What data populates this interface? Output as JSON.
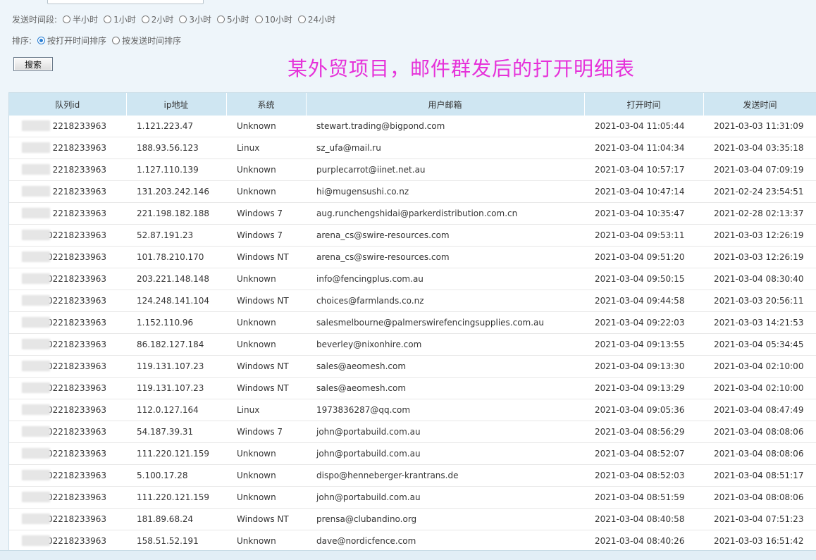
{
  "filters": {
    "send_period_label": "发送时间段:",
    "send_period_options": [
      "半小时",
      "1小时",
      "2小时",
      "3小时",
      "5小时",
      "10小时",
      "24小时"
    ],
    "sort_label": "排序:",
    "sort_options": [
      "按打开时间排序",
      "按发送时间排序"
    ],
    "sort_selected": 0,
    "search_button": "搜索"
  },
  "overlay_caption": "某外贸项目，邮件群发后的打开明细表",
  "table": {
    "columns": [
      "队列id",
      "ip地址",
      "系统",
      "用户邮箱",
      "打开时间",
      "发送时间"
    ],
    "rows": [
      [
        "2218233963",
        "1.121.223.47",
        "Unknown",
        "stewart.trading@bigpond.com",
        "2021-03-04 11:05:44",
        "2021-03-03 11:31:09"
      ],
      [
        "2218233963",
        "188.93.56.123",
        "Linux",
        "sz_ufa@mail.ru",
        "2021-03-04 11:04:34",
        "2021-03-04 03:35:18"
      ],
      [
        "2218233963",
        "1.127.110.139",
        "Unknown",
        "purplecarrot@iinet.net.au",
        "2021-03-04 10:57:17",
        "2021-03-04 07:09:19"
      ],
      [
        "2218233963",
        "131.203.242.146",
        "Unknown",
        "hi@mugensushi.co.nz",
        "2021-03-04 10:47:14",
        "2021-02-24 23:54:51"
      ],
      [
        "2218233963",
        "221.198.182.188",
        "Windows 7",
        "aug.runchengshidai@parkerdistribution.com.cn",
        "2021-03-04 10:35:47",
        "2021-02-28 02:13:37"
      ],
      [
        "02218233963",
        "52.87.191.23",
        "Windows 7",
        "arena_cs@swire-resources.com",
        "2021-03-04 09:53:11",
        "2021-03-03 12:26:19"
      ],
      [
        "02218233963",
        "101.78.210.170",
        "Windows NT",
        "arena_cs@swire-resources.com",
        "2021-03-04 09:51:20",
        "2021-03-03 12:26:19"
      ],
      [
        "102218233963",
        "203.221.148.148",
        "Unknown",
        "info@fencingplus.com.au",
        "2021-03-04 09:50:15",
        "2021-03-04 08:30:40"
      ],
      [
        "102218233963",
        "124.248.141.104",
        "Windows NT",
        "choices@farmlands.co.nz",
        "2021-03-04 09:44:58",
        "2021-03-03 20:56:11"
      ],
      [
        "102218233963",
        "1.152.110.96",
        "Unknown",
        "salesmelbourne@palmerswirefencingsupplies.com.au",
        "2021-03-04 09:22:03",
        "2021-03-03 14:21:53"
      ],
      [
        "102218233963",
        "86.182.127.184",
        "Unknown",
        "beverley@nixonhire.com",
        "2021-03-04 09:13:55",
        "2021-03-04 05:34:45"
      ],
      [
        "102218233963",
        "119.131.107.23",
        "Windows NT",
        "sales@aeomesh.com",
        "2021-03-04 09:13:30",
        "2021-03-04 02:10:00"
      ],
      [
        "2102218233963",
        "119.131.107.23",
        "Windows NT",
        "sales@aeomesh.com",
        "2021-03-04 09:13:29",
        "2021-03-04 02:10:00"
      ],
      [
        "2102218233963",
        "112.0.127.164",
        "Linux",
        "1973836287@qq.com",
        "2021-03-04 09:05:36",
        "2021-03-04 08:47:49"
      ],
      [
        "2102218233963",
        "54.187.39.31",
        "Windows 7",
        "john@portabuild.com.au",
        "2021-03-04 08:56:29",
        "2021-03-04 08:08:06"
      ],
      [
        "102218233963",
        "111.220.121.159",
        "Unknown",
        "john@portabuild.com.au",
        "2021-03-04 08:52:07",
        "2021-03-04 08:08:06"
      ],
      [
        "102218233963",
        "5.100.17.28",
        "Unknown",
        "dispo@henneberger-krantrans.de",
        "2021-03-04 08:52:03",
        "2021-03-04 08:51:17"
      ],
      [
        "02218233963",
        "111.220.121.159",
        "Unknown",
        "john@portabuild.com.au",
        "2021-03-04 08:51:59",
        "2021-03-04 08:08:06"
      ],
      [
        "02218233963",
        "181.89.68.24",
        "Windows NT",
        "prensa@clubandino.org",
        "2021-03-04 08:40:58",
        "2021-03-04 07:51:23"
      ],
      [
        "2102218233963",
        "158.51.52.191",
        "Unknown",
        "dave@nordicfence.com",
        "2021-03-04 08:40:26",
        "2021-03-03 16:51:42"
      ]
    ]
  },
  "colors": {
    "header_bg": "#cfe6f2",
    "caption": "#e631d9",
    "radio_selected": "#2a7fd4"
  }
}
